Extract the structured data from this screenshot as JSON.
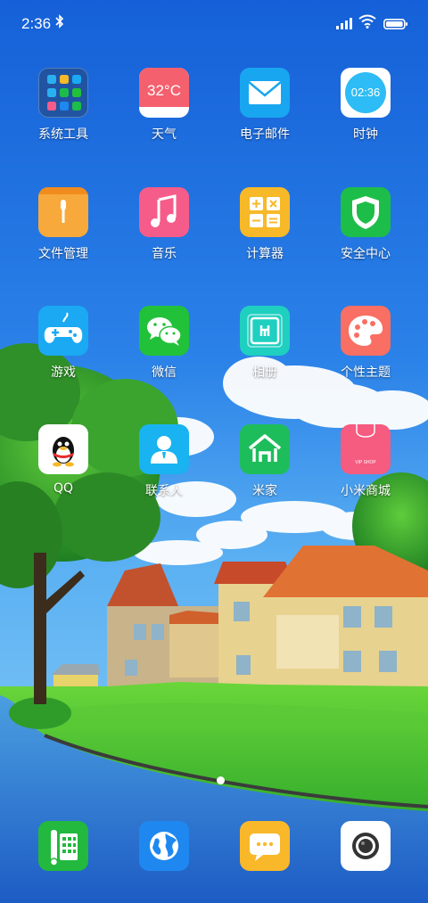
{
  "status_bar": {
    "time": "2:36"
  },
  "pages": {
    "current": 1,
    "count": 1
  },
  "apps": [
    {
      "label": "系统工具",
      "icon": "system-tools-folder-icon"
    },
    {
      "label": "天气",
      "icon": "weather-icon",
      "value": "32°C",
      "color": "#f4606e"
    },
    {
      "label": "电子邮件",
      "icon": "email-icon",
      "color": "#19a6f0"
    },
    {
      "label": "时钟",
      "icon": "clock-icon",
      "value": "02:36",
      "color": "#2dbcf5"
    },
    {
      "label": "文件管理",
      "icon": "file-manager-icon",
      "color": "#f7a93c"
    },
    {
      "label": "音乐",
      "icon": "music-icon",
      "color": "#f55c8a"
    },
    {
      "label": "计算器",
      "icon": "calculator-icon",
      "color": "#f7b928"
    },
    {
      "label": "安全中心",
      "icon": "security-shield-icon",
      "color": "#1dbd4a"
    },
    {
      "label": "游戏",
      "icon": "game-controller-icon",
      "color": "#1aa9f2"
    },
    {
      "label": "微信",
      "icon": "wechat-icon",
      "color": "#22c13a"
    },
    {
      "label": "相册",
      "icon": "gallery-icon",
      "color": "#1fcfc0"
    },
    {
      "label": "个性主题",
      "icon": "theme-palette-icon",
      "color": "#f96f63"
    },
    {
      "label": "QQ",
      "icon": "qq-penguin-icon",
      "color": "#ffffff"
    },
    {
      "label": "联系人",
      "icon": "contacts-icon",
      "color": "#18b3f0"
    },
    {
      "label": "米家",
      "icon": "mijia-home-icon",
      "color": "#1ebd5b"
    },
    {
      "label": "小米商城",
      "icon": "mi-store-bag-icon",
      "color": "#f65b80",
      "value": "VIP SHOP"
    }
  ],
  "dock": [
    {
      "icon": "phone-icon",
      "color": "#23b83e"
    },
    {
      "icon": "browser-globe-icon",
      "color": "#1e88f0"
    },
    {
      "icon": "messages-icon",
      "color": "#f9b82a"
    },
    {
      "icon": "camera-icon",
      "color": "#ffffff"
    }
  ]
}
